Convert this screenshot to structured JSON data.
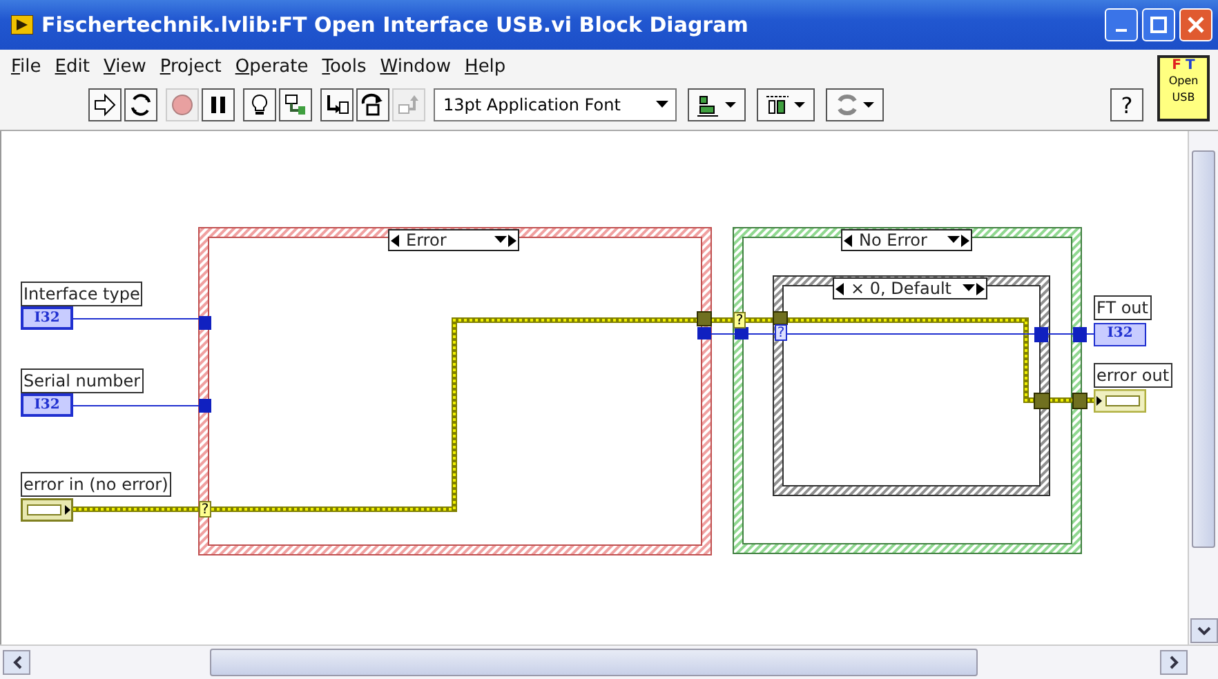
{
  "window": {
    "title": "Fischertechnik.lvlib:FT Open Interface USB.vi Block Diagram"
  },
  "menu": [
    "File",
    "Edit",
    "View",
    "Project",
    "Operate",
    "Tools",
    "Window",
    "Help"
  ],
  "toolbar": {
    "buttons": [
      {
        "kind": "run",
        "disabled": false
      },
      {
        "kind": "run-continuous",
        "disabled": false
      },
      {
        "kind": "abort",
        "disabled": true
      },
      {
        "kind": "pause",
        "disabled": false
      },
      {
        "kind": "highlight",
        "disabled": false
      },
      {
        "kind": "retain",
        "disabled": false
      },
      {
        "kind": "step-into",
        "disabled": false
      },
      {
        "kind": "step-over",
        "disabled": false
      },
      {
        "kind": "step-out",
        "disabled": true
      }
    ],
    "font": "13pt Application Font",
    "help": "?"
  },
  "vi_icon": {
    "top": [
      "F",
      "T"
    ],
    "middle": "Open",
    "bottom": "USB"
  },
  "diagram": {
    "structures": [
      {
        "kind": "error",
        "selector": "Error"
      },
      {
        "kind": "no-error",
        "selector": "No Error"
      },
      {
        "kind": "default",
        "selector": "× 0, Default"
      }
    ],
    "controls": [
      {
        "kind": "numeric",
        "label": "Interface type",
        "terminal": "I32"
      },
      {
        "kind": "numeric",
        "label": "Serial number",
        "terminal": "I32"
      },
      {
        "kind": "cluster",
        "label": "error in (no error)"
      }
    ],
    "indicators": [
      {
        "kind": "numeric",
        "label": "FT out",
        "terminal": "I32"
      },
      {
        "kind": "cluster",
        "label": "error out"
      }
    ],
    "tunnel_marks": [
      "?",
      "?",
      "?"
    ]
  }
}
